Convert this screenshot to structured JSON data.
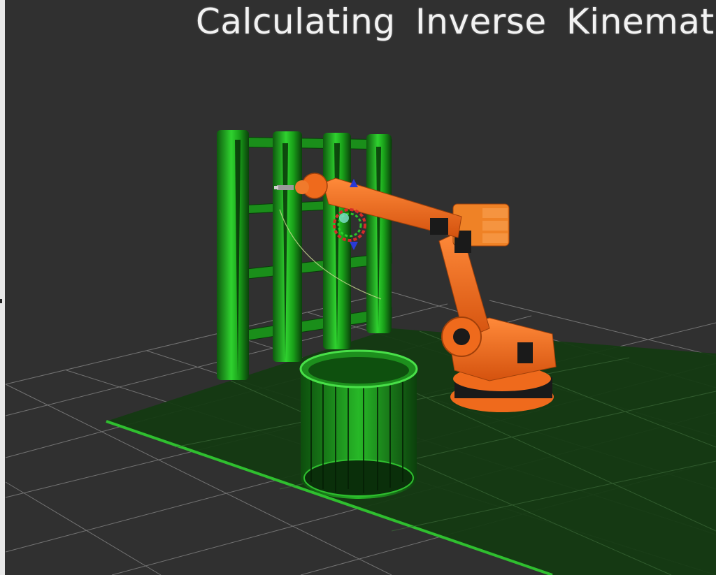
{
  "overlay": {
    "title": "Calculating  Inverse  Kinemat"
  },
  "colors": {
    "background": "#303030",
    "grid": "#8a8a8a",
    "floor_plane": "#143a12",
    "floor_edge": "#2fbf2f",
    "shelf": "#1fa01f",
    "bin": "#1c8a1c",
    "robot": "#ef6a1c",
    "robot_dark": "#1a1a1a",
    "marker_red": "#d62a2a",
    "marker_green": "#2ad62a",
    "marker_blue": "#2a3ad6"
  },
  "scene": {
    "objects": [
      {
        "name": "shelf",
        "icon": "shelf-model"
      },
      {
        "name": "bin",
        "icon": "bin-model"
      },
      {
        "name": "robot-arm",
        "icon": "industrial-robot-arm"
      },
      {
        "name": "target-marker",
        "icon": "pose-gizmo"
      },
      {
        "name": "grid",
        "icon": "reference-grid"
      }
    ]
  }
}
